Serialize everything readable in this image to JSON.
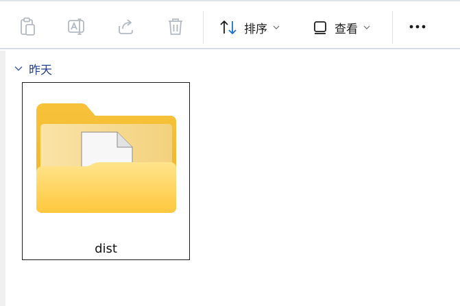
{
  "toolbar": {
    "buttons": [
      {
        "icon": "clipboard-icon",
        "enabled": false
      },
      {
        "icon": "rename-icon",
        "enabled": false
      },
      {
        "icon": "share-icon",
        "enabled": false
      },
      {
        "icon": "trash-icon",
        "enabled": false
      }
    ],
    "sort_label": "排序",
    "view_label": "查看",
    "more_icon": "more-icon",
    "disabled_color": "#b3b9c3",
    "text_color": "#1b1b1b",
    "accent_color": "#1a6fce"
  },
  "group": {
    "label": "昨天",
    "expanded": true
  },
  "items": [
    {
      "name": "dist",
      "type": "folder",
      "selected": true
    }
  ]
}
